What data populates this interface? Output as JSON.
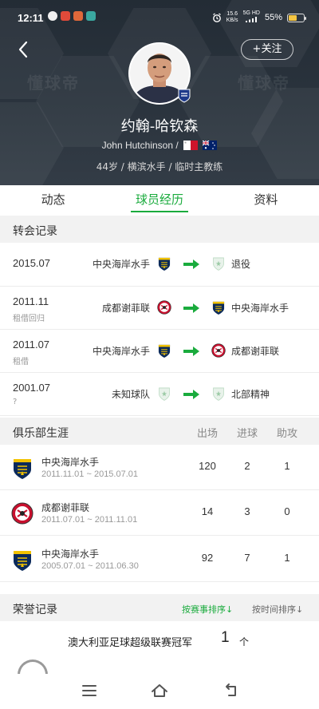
{
  "status_bar": {
    "time": "12:11",
    "network_speed_value": "15.6",
    "network_speed_unit": "KB/s",
    "network_type": "5G HD",
    "battery": "55%",
    "battery_level": 0.55
  },
  "header": {
    "follow_label": "+关注",
    "watermark": "懂球帝",
    "player_name": "约翰-哈钦森",
    "english_name": "John Hutchinson",
    "name_separator": "/",
    "meta": "44岁 / 横滨水手 / 临时主教练"
  },
  "tabs": [
    {
      "label": "动态",
      "active": false
    },
    {
      "label": "球员经历",
      "active": true
    },
    {
      "label": "资料",
      "active": false
    }
  ],
  "transfers": {
    "title": "转会记录",
    "rows": [
      {
        "date": "2015.07",
        "note": "",
        "from": "中央海岸水手",
        "from_icon": "mariners-crest-icon",
        "to": "退役",
        "to_icon": "generic-shield-icon"
      },
      {
        "date": "2011.11",
        "note": "租借回归",
        "from": "成都谢菲联",
        "from_icon": "sheffield-crest-icon",
        "to": "中央海岸水手",
        "to_icon": "mariners-crest-icon"
      },
      {
        "date": "2011.07",
        "note": "租借",
        "from": "中央海岸水手",
        "from_icon": "mariners-crest-icon",
        "to": "成都谢菲联",
        "to_icon": "sheffield-crest-icon"
      },
      {
        "date": "2001.07",
        "note": "?",
        "from": "未知球队",
        "from_icon": "generic-shield-icon",
        "to": "北部精神",
        "to_icon": "generic-shield-icon"
      }
    ]
  },
  "career": {
    "title": "俱乐部生涯",
    "columns": [
      "出场",
      "进球",
      "助攻"
    ],
    "rows": [
      {
        "club": "中央海岸水手",
        "period": "2011.11.01 ~ 2015.07.01",
        "apps": "120",
        "goals": "2",
        "assists": "1",
        "logo": "mariners-crest-icon"
      },
      {
        "club": "成都谢菲联",
        "period": "2011.07.01 ~ 2011.11.01",
        "apps": "14",
        "goals": "3",
        "assists": "0",
        "logo": "sheffield-crest-icon"
      },
      {
        "club": "中央海岸水手",
        "period": "2005.07.01 ~ 2011.06.30",
        "apps": "92",
        "goals": "7",
        "assists": "1",
        "logo": "mariners-crest-icon"
      }
    ]
  },
  "honours": {
    "title": "荣誉记录",
    "sort_by_competition": "按赛事排序↓",
    "sort_by_time": "按时间排序↓",
    "items": [
      {
        "name": "澳大利亚足球超级联赛冠军",
        "count": "1",
        "unit": "个"
      }
    ]
  },
  "colors": {
    "accent": "#1aab3d",
    "header_bg": "#2a333d",
    "section_bg": "#f2f2f2"
  }
}
